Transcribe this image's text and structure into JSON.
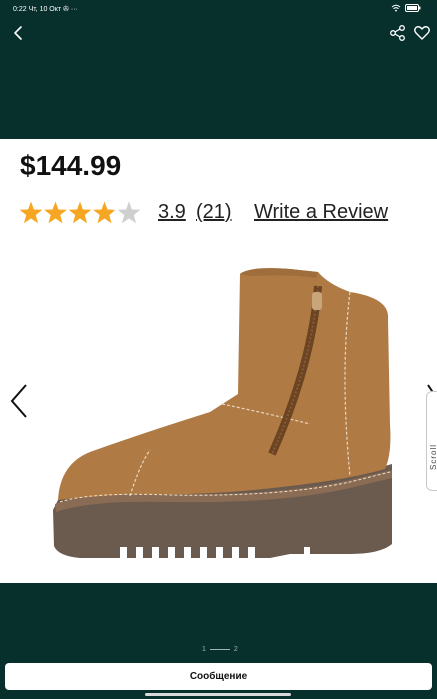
{
  "status_bar": {
    "time": "0:22",
    "date": "Чт, 10 Окт",
    "battery": "100"
  },
  "product": {
    "price": "$144.99",
    "rating_value": "3.9",
    "rating_count": "(21)",
    "write_review": "Write a Review",
    "rating_stars": 3.9,
    "rating_max": 5
  },
  "side_tab": {
    "label": "Scroll"
  },
  "pager": {
    "current": "1",
    "total": "2"
  },
  "actions": {
    "message_label": "Сообщение"
  },
  "colors": {
    "background": "#07302d",
    "star_fill": "#f5a623",
    "star_empty": "#cfcfcf",
    "boot_suede": "#b07a45",
    "boot_sole": "#6b5a4e"
  },
  "icons": {
    "back": "chevron-left-icon",
    "share": "share-icon",
    "favorite": "heart-icon",
    "prev": "chevron-left-icon",
    "next": "chevron-right-icon"
  }
}
